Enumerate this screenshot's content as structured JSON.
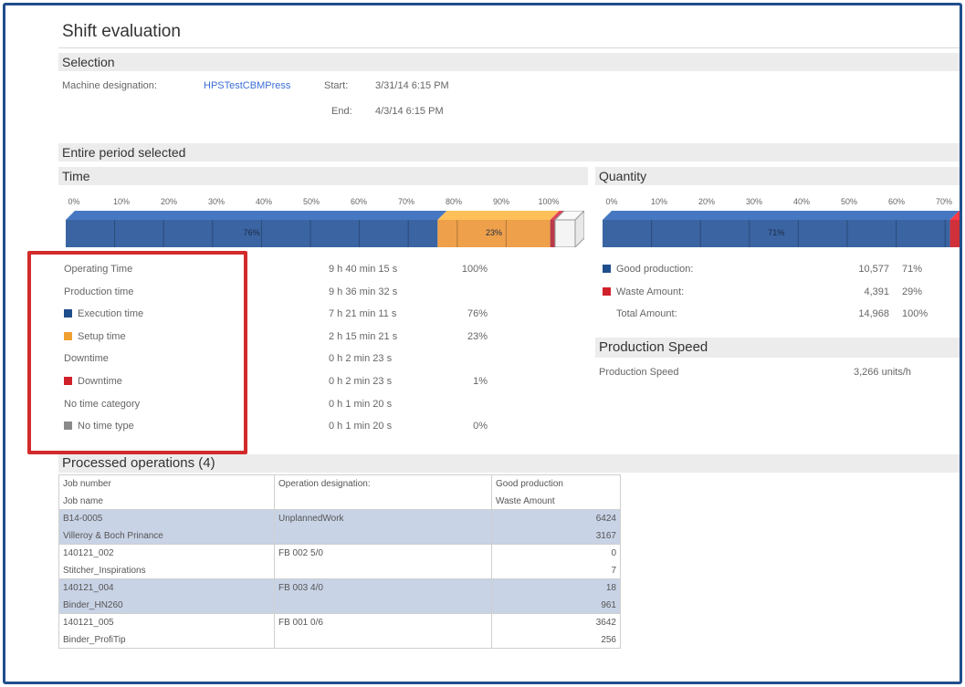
{
  "page": {
    "title": "Shift evaluation"
  },
  "selection": {
    "header": "Selection",
    "machine_label": "Machine designation:",
    "machine_value": "HPSTestCBMPress",
    "start_label": "Start:",
    "start_value": "3/31/14 6:15 PM",
    "end_label": "End:",
    "end_value": "4/3/14 6:15 PM"
  },
  "period": {
    "header": "Entire period selected"
  },
  "time": {
    "header": "Time",
    "axis_ticks": [
      "0%",
      "10%",
      "20%",
      "30%",
      "40%",
      "50%",
      "60%",
      "70%",
      "80%",
      "90%",
      "100%"
    ],
    "bar_segments": [
      {
        "label": "76%",
        "fraction": 0.76,
        "color": "#3a64a2"
      },
      {
        "label": "23%",
        "fraction": 0.23,
        "color": "#eea04a"
      },
      {
        "label": "",
        "fraction": 0.01,
        "color": "#b93a4a"
      }
    ],
    "rows": [
      {
        "label": "Operating Time",
        "value": "9 h 40 min 15 s",
        "percent": "100%",
        "legend_color": ""
      },
      {
        "label": "Production time",
        "value": "9 h 36 min 32 s",
        "percent": "",
        "legend_color": ""
      },
      {
        "label": "Execution time",
        "value": "7 h 21 min 11 s",
        "percent": "76%",
        "legend_color": "#1f4e8c"
      },
      {
        "label": "Setup time",
        "value": "2 h 15 min 21 s",
        "percent": "23%",
        "legend_color": "#f0a030"
      },
      {
        "label": "Downtime",
        "value": "0 h  2 min 23 s",
        "percent": "",
        "legend_color": ""
      },
      {
        "label": "Downtime",
        "value": "0 h  2 min 23 s",
        "percent": "1%",
        "legend_color": "#d0202a"
      },
      {
        "label": "No time category",
        "value": "0 h  1 min 20 s",
        "percent": "",
        "legend_color": ""
      },
      {
        "label": "No time type",
        "value": "0 h  1 min 20 s",
        "percent": "0%",
        "legend_color": "#8a8a8a"
      }
    ]
  },
  "quantity": {
    "header": "Quantity",
    "axis_ticks": [
      "0%",
      "10%",
      "20%",
      "30%",
      "40%",
      "50%",
      "60%",
      "70%"
    ],
    "bar_segments": [
      {
        "label": "71%",
        "fraction": 0.71,
        "color": "#3a64a2"
      },
      {
        "label": "",
        "fraction": 0.29,
        "color": "#d0303a"
      }
    ],
    "rows": [
      {
        "label": "Good production:",
        "value": "10,577",
        "percent": "71%",
        "legend_color": "#1f4e8c"
      },
      {
        "label": "Waste Amount:",
        "value": "4,391",
        "percent": "29%",
        "legend_color": "#d0202a"
      },
      {
        "label": "Total Amount:",
        "value": "14,968",
        "percent": "100%",
        "legend_color": ""
      }
    ]
  },
  "speed": {
    "header": "Production Speed",
    "label": "Production Speed",
    "value": "3,266 units/h"
  },
  "operations": {
    "header": "Processed operations (4)",
    "columns": {
      "job_number": "Job number",
      "job_name": "Job name",
      "operation": "Operation designation:",
      "good": "Good production",
      "waste": "Waste Amount"
    },
    "rows": [
      {
        "job_number": "B14-0005",
        "job_name": "Villeroy & Boch Prinance",
        "operation": "UnplannedWork",
        "good": "6424",
        "waste": "3167",
        "shaded": true
      },
      {
        "job_number": "140121_002",
        "job_name": "Stitcher_Inspirations",
        "operation": "FB 002  5/0",
        "good": "0",
        "waste": "7",
        "shaded": false
      },
      {
        "job_number": "140121_004",
        "job_name": "Binder_HN260",
        "operation": "FB 003  4/0",
        "good": "18",
        "waste": "961",
        "shaded": true
      },
      {
        "job_number": "140121_005",
        "job_name": "Binder_ProfiTip",
        "operation": "FB 001  0/6",
        "good": "3642",
        "waste": "256",
        "shaded": false
      }
    ]
  }
}
